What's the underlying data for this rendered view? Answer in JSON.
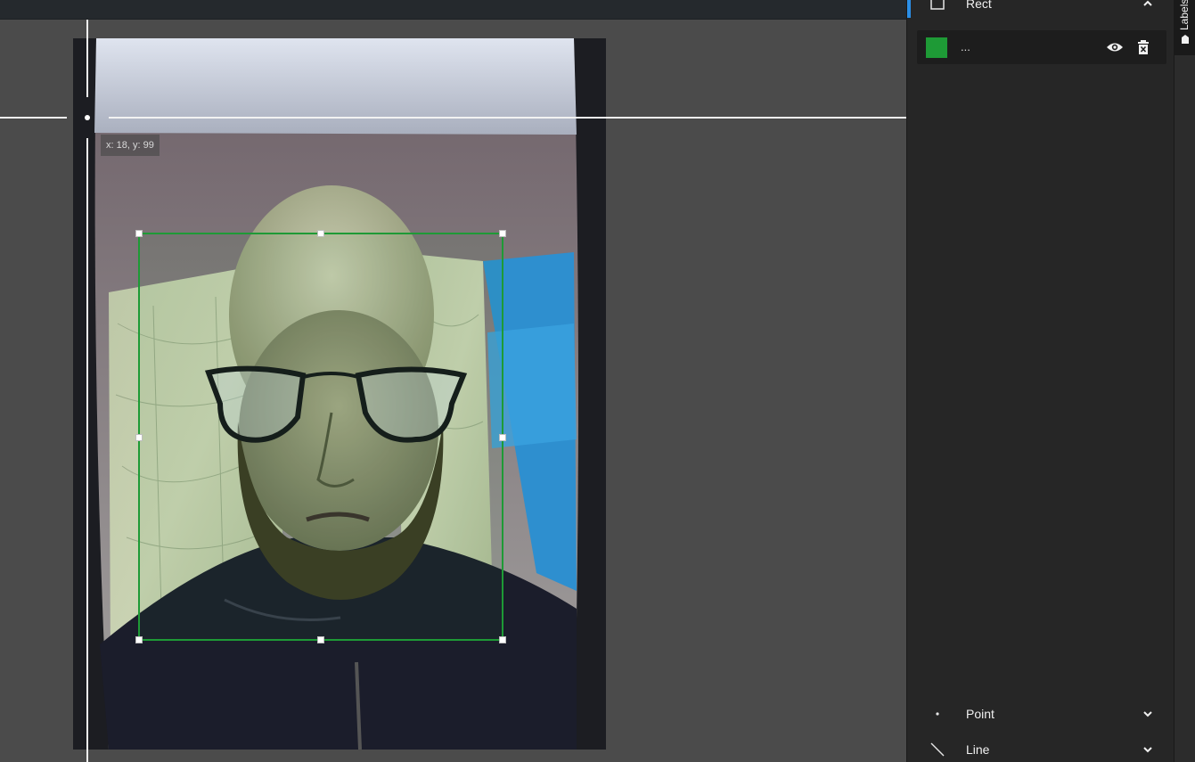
{
  "canvas": {
    "coord_readout": "x: 18, y: 99"
  },
  "panel": {
    "rect_section": {
      "label": "Rect",
      "icon": "rect-tool-icon",
      "state": "expanded"
    },
    "label_item": {
      "name": "...",
      "color": "#1e9a36",
      "visible_icon": "eye-icon",
      "delete_icon": "delete-icon"
    },
    "point_section": {
      "label": "Point",
      "icon": "point-tool-icon",
      "state": "collapsed"
    },
    "line_section": {
      "label": "Line",
      "icon": "line-tool-icon",
      "state": "collapsed"
    }
  },
  "sidetab": {
    "label": "Labels",
    "icon": "tag-icon"
  },
  "colors": {
    "accent": "#2b8ee6",
    "bbox": "#1e9a36",
    "panel_bg": "#262626"
  }
}
